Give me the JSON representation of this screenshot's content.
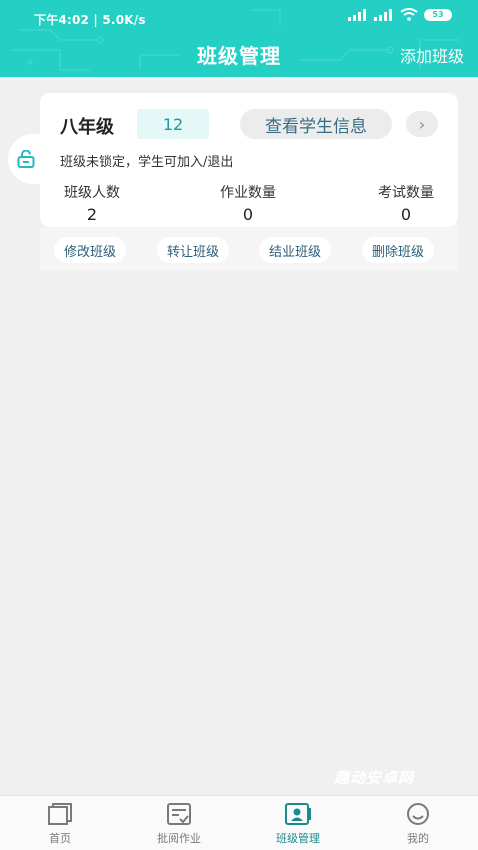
{
  "status": {
    "time_speed": "下午4:02 | 5.0K/s",
    "battery": "53"
  },
  "header": {
    "title": "班级管理",
    "add_button": "添加班级"
  },
  "class_card": {
    "grade": "八年级",
    "student_badge": "12",
    "view_button": "查看学生信息",
    "arrow": "›",
    "lock_note": "班级未锁定，学生可加入/退出",
    "stats": [
      {
        "label": "班级人数",
        "value": "2"
      },
      {
        "label": "作业数量",
        "value": "0"
      },
      {
        "label": "考试数量",
        "value": "0"
      }
    ],
    "actions": [
      "修改班级",
      "转让班级",
      "结业班级",
      "删除班级"
    ]
  },
  "watermark": "趣动安卓网",
  "tabbar": {
    "items": [
      {
        "label": "首页",
        "icon": "home-icon"
      },
      {
        "label": "批阅作业",
        "icon": "review-icon"
      },
      {
        "label": "班级管理",
        "icon": "class-icon"
      },
      {
        "label": "我的",
        "icon": "profile-icon"
      }
    ],
    "active_index": 2
  },
  "colors": {
    "accent": "#24cfc3",
    "active_tab": "#1a8a8c",
    "background": "#f0f0f0"
  }
}
